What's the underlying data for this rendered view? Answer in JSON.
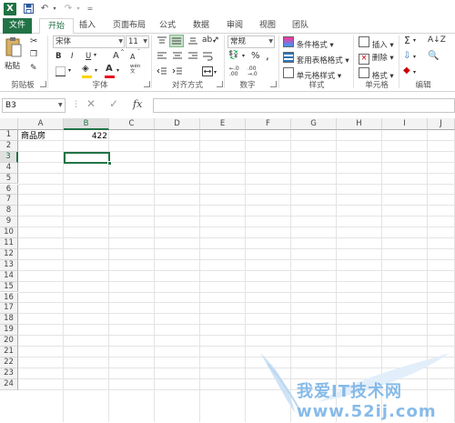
{
  "title_bar": {
    "logo_letter": "X",
    "quick_access": [
      "save-icon",
      "undo-icon",
      "redo-icon",
      "customize-icon"
    ]
  },
  "tabs": [
    "文件",
    "开始",
    "插入",
    "页面布局",
    "公式",
    "数据",
    "审阅",
    "视图",
    "团队"
  ],
  "active_tab": "开始",
  "ribbon": {
    "clipboard": {
      "paste_label": "粘贴",
      "group_label": "剪贴板"
    },
    "font": {
      "font_name": "宋体",
      "font_size": "11",
      "bold": "B",
      "italic": "I",
      "underline": "U",
      "grow": "A",
      "shrink": "A",
      "font_color": "A",
      "phonetic": "wén",
      "group_label": "字体"
    },
    "alignment": {
      "group_label": "对齐方式"
    },
    "number": {
      "format": "常规",
      "group_label": "数字",
      "percent": "%",
      "comma": ","
    },
    "styles": {
      "conditional": "条件格式",
      "table": "套用表格格式",
      "cell": "单元格样式",
      "group_label": "样式"
    },
    "cells": {
      "insert": "插入",
      "delete": "删除",
      "format": "格式",
      "group_label": "单元格"
    },
    "editing": {
      "group_label": "编辑"
    }
  },
  "formula_bar": {
    "name_box": "B3",
    "fx_label": "fx",
    "formula": ""
  },
  "columns": [
    "A",
    "B",
    "C",
    "D",
    "E",
    "F",
    "G",
    "H",
    "I",
    "J"
  ],
  "rows": [
    "1",
    "2",
    "3",
    "4",
    "5",
    "6",
    "7",
    "8",
    "9",
    "10",
    "11",
    "12",
    "13",
    "14",
    "15",
    "16",
    "17",
    "18",
    "19",
    "20",
    "21",
    "22",
    "23",
    "24"
  ],
  "cells": {
    "A1": "商品房",
    "B1": "422"
  },
  "selected_cell": "B3",
  "watermark": "我爱IT技术网 www.52ij.com",
  "colors": {
    "accent": "#217346",
    "selection": "#217346"
  }
}
